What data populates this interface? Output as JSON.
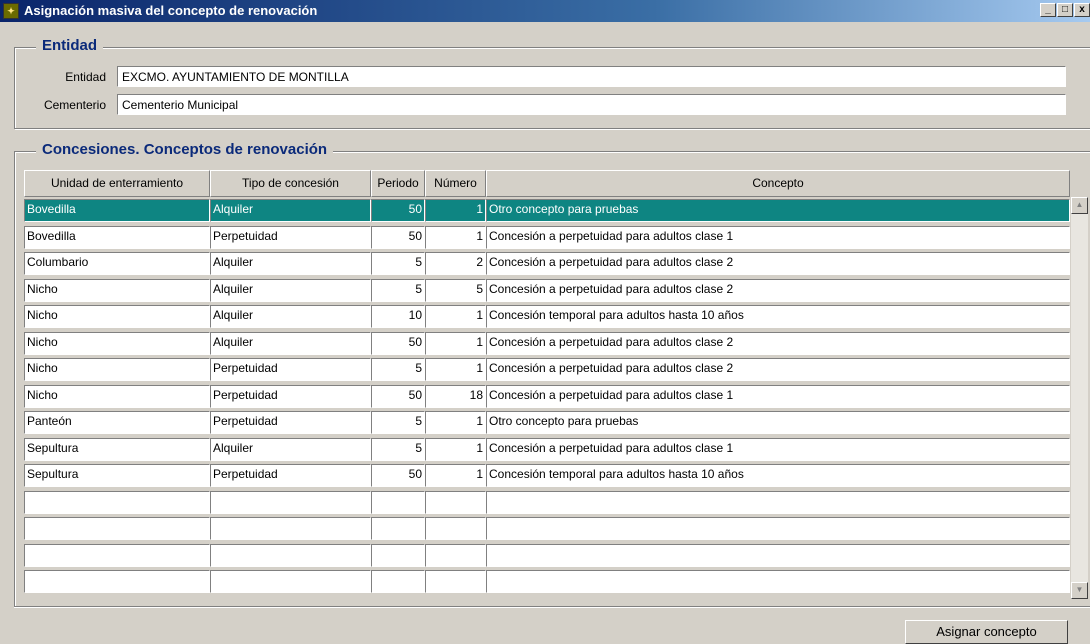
{
  "window": {
    "title": "Asignación masiva del concepto de renovación",
    "minimize_glyph": "_",
    "maximize_glyph": "□",
    "close_glyph": "x"
  },
  "entidad": {
    "legend": "Entidad",
    "entidad_label": "Entidad",
    "entidad_value": "EXCMO. AYUNTAMIENTO DE MONTILLA",
    "cementerio_label": "Cementerio",
    "cementerio_value": "Cementerio Municipal"
  },
  "concesiones": {
    "legend": "Concesiones. Conceptos de renovación",
    "columns": [
      "Unidad de enterramiento",
      "Tipo de concesión",
      "Periodo",
      "Número",
      "Concepto"
    ],
    "rows": [
      {
        "unidad": "Bovedilla",
        "tipo": "Alquiler",
        "periodo": "50",
        "numero": "1",
        "concepto": "Otro concepto para pruebas"
      },
      {
        "unidad": "Bovedilla",
        "tipo": "Perpetuidad",
        "periodo": "50",
        "numero": "1",
        "concepto": "Concesión  a perpetuidad para adultos clase 1"
      },
      {
        "unidad": "Columbario",
        "tipo": "Alquiler",
        "periodo": "5",
        "numero": "2",
        "concepto": "Concesión a perpetuidad para adultos clase 2"
      },
      {
        "unidad": "Nicho",
        "tipo": "Alquiler",
        "periodo": "5",
        "numero": "5",
        "concepto": "Concesión a perpetuidad para adultos clase 2"
      },
      {
        "unidad": "Nicho",
        "tipo": "Alquiler",
        "periodo": "10",
        "numero": "1",
        "concepto": "Concesión temporal para adultos hasta 10 años"
      },
      {
        "unidad": "Nicho",
        "tipo": "Alquiler",
        "periodo": "50",
        "numero": "1",
        "concepto": "Concesión a perpetuidad para adultos clase 2"
      },
      {
        "unidad": "Nicho",
        "tipo": "Perpetuidad",
        "periodo": "5",
        "numero": "1",
        "concepto": "Concesión a perpetuidad para adultos clase 2"
      },
      {
        "unidad": "Nicho",
        "tipo": "Perpetuidad",
        "periodo": "50",
        "numero": "18",
        "concepto": "Concesión  a perpetuidad para adultos clase 1"
      },
      {
        "unidad": "Panteón",
        "tipo": "Perpetuidad",
        "periodo": "5",
        "numero": "1",
        "concepto": "Otro concepto para pruebas"
      },
      {
        "unidad": "Sepultura",
        "tipo": "Alquiler",
        "periodo": "5",
        "numero": "1",
        "concepto": "Concesión  a perpetuidad para adultos clase 1"
      },
      {
        "unidad": "Sepultura",
        "tipo": "Perpetuidad",
        "periodo": "50",
        "numero": "1",
        "concepto": "Concesión temporal para adultos hasta 10 años"
      },
      {
        "unidad": "",
        "tipo": "",
        "periodo": "",
        "numero": "",
        "concepto": ""
      },
      {
        "unidad": "",
        "tipo": "",
        "periodo": "",
        "numero": "",
        "concepto": ""
      },
      {
        "unidad": "",
        "tipo": "",
        "periodo": "",
        "numero": "",
        "concepto": ""
      },
      {
        "unidad": "",
        "tipo": "",
        "periodo": "",
        "numero": "",
        "concepto": ""
      }
    ],
    "selected_row_index": 0,
    "selection_color": "#0e8582"
  },
  "scrollbar": {
    "up_glyph": "▲",
    "down_glyph": "▼"
  },
  "actions": {
    "asignar_label": "Asignar concepto"
  }
}
